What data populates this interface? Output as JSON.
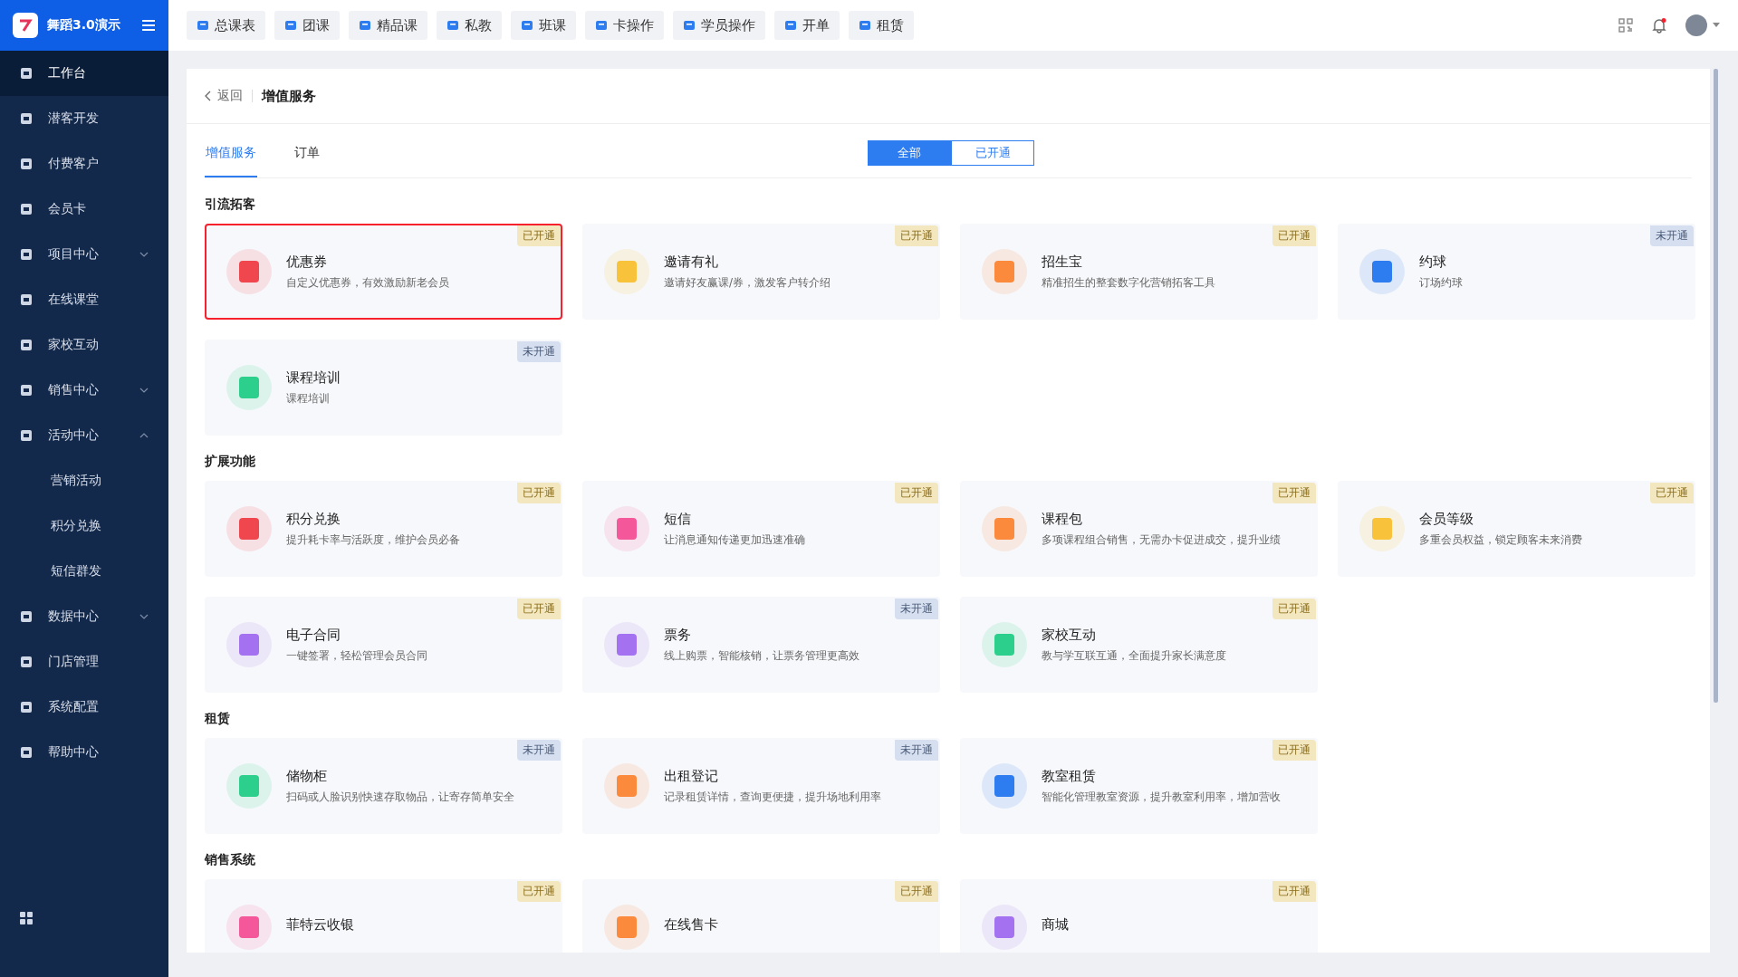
{
  "brand": {
    "name": "舞蹈3.0演示"
  },
  "top_nav": [
    {
      "label": "总课表"
    },
    {
      "label": "团课"
    },
    {
      "label": "精品课"
    },
    {
      "label": "私教"
    },
    {
      "label": "班课"
    },
    {
      "label": "卡操作"
    },
    {
      "label": "学员操作"
    },
    {
      "label": "开单"
    },
    {
      "label": "租赁"
    }
  ],
  "sidebar": {
    "items": [
      {
        "label": "工作台",
        "selected": true
      },
      {
        "label": "潜客开发",
        "selected": false
      },
      {
        "label": "付费客户",
        "selected": false
      },
      {
        "label": "会员卡",
        "selected": false
      },
      {
        "label": "项目中心",
        "selected": false,
        "expanded": false
      },
      {
        "label": "在线课堂",
        "selected": false
      },
      {
        "label": "家校互动",
        "selected": false
      },
      {
        "label": "销售中心",
        "selected": false,
        "expanded": false
      },
      {
        "label": "活动中心",
        "selected": false,
        "expanded": true,
        "children": [
          {
            "label": "营销活动",
            "selected": false
          },
          {
            "label": "积分兑换",
            "selected": false
          },
          {
            "label": "短信群发",
            "selected": false
          }
        ]
      },
      {
        "label": "数据中心",
        "selected": false,
        "expanded": false
      },
      {
        "label": "门店管理",
        "selected": false
      },
      {
        "label": "系统配置",
        "selected": false
      },
      {
        "label": "帮助中心",
        "selected": false
      }
    ]
  },
  "header": {
    "back": "返回",
    "title": "增值服务"
  },
  "tabs": [
    {
      "label": "增值服务",
      "selected": true
    },
    {
      "label": "订单",
      "selected": false
    }
  ],
  "filter": [
    {
      "label": "全部",
      "selected": true
    },
    {
      "label": "已开通",
      "selected": false
    }
  ],
  "sections": [
    {
      "title": "引流拓客",
      "cards": [
        {
          "title": "优惠券",
          "desc": "自定义优惠券，有效激励新老会员",
          "status": "已开通",
          "opened": true,
          "selected": true,
          "color": "#f0474f"
        },
        {
          "title": "邀请有礼",
          "desc": "邀请好友赢课/券，激发客户转介绍",
          "status": "已开通",
          "opened": true,
          "selected": false,
          "color": "#f8c23a"
        },
        {
          "title": "招生宝",
          "desc": "精准招生的整套数字化营销拓客工具",
          "status": "已开通",
          "opened": true,
          "selected": false,
          "color": "#fb8a3c"
        },
        {
          "title": "约球",
          "desc": "订场约球",
          "status": "未开通",
          "opened": false,
          "selected": false,
          "color": "#2d7cf0"
        },
        {
          "title": "课程培训",
          "desc": "课程培训",
          "status": "未开通",
          "opened": false,
          "selected": false,
          "color": "#2ccf8c"
        }
      ]
    },
    {
      "title": "扩展功能",
      "cards": [
        {
          "title": "积分兑换",
          "desc": "提升耗卡率与活跃度，维护会员必备",
          "status": "已开通",
          "opened": true,
          "selected": false,
          "color": "#f0474f"
        },
        {
          "title": "短信",
          "desc": "让消息通知传递更加迅速准确",
          "status": "已开通",
          "opened": true,
          "selected": false,
          "color": "#f5589a"
        },
        {
          "title": "课程包",
          "desc": "多项课程组合销售，无需办卡促进成交，提升业绩",
          "status": "已开通",
          "opened": true,
          "selected": false,
          "color": "#fb8a3c"
        },
        {
          "title": "会员等级",
          "desc": "多重会员权益，锁定顾客未来消费",
          "status": "已开通",
          "opened": true,
          "selected": false,
          "color": "#f8c23a"
        },
        {
          "title": "电子合同",
          "desc": "一键签署，轻松管理会员合同",
          "status": "已开通",
          "opened": true,
          "selected": false,
          "color": "#a472f0"
        },
        {
          "title": "票务",
          "desc": "线上购票，智能核销，让票务管理更高效",
          "status": "未开通",
          "opened": false,
          "selected": false,
          "color": "#a472f0"
        },
        {
          "title": "家校互动",
          "desc": "教与学互联互通，全面提升家长满意度",
          "status": "已开通",
          "opened": true,
          "selected": false,
          "color": "#2ccf8c"
        }
      ]
    },
    {
      "title": "租赁",
      "cards": [
        {
          "title": "储物柜",
          "desc": "扫码或人脸识别快速存取物品，让寄存简单安全",
          "status": "未开通",
          "opened": false,
          "selected": false,
          "color": "#2ccf8c"
        },
        {
          "title": "出租登记",
          "desc": "记录租赁详情，查询更便捷，提升场地利用率",
          "status": "未开通",
          "opened": false,
          "selected": false,
          "color": "#fb8a3c"
        },
        {
          "title": "教室租赁",
          "desc": "智能化管理教室资源，提升教室利用率，增加营收",
          "status": "已开通",
          "opened": true,
          "selected": false,
          "color": "#2d7cf0"
        }
      ]
    },
    {
      "title": "销售系统",
      "cards": [
        {
          "title": "菲特云收银",
          "status": "已开通",
          "opened": true,
          "selected": false,
          "color": "#f5589a"
        },
        {
          "title": "在线售卡",
          "status": "已开通",
          "opened": true,
          "selected": false,
          "color": "#fb8a3c"
        },
        {
          "title": "商城",
          "status": "已开通",
          "opened": true,
          "selected": false,
          "color": "#a472f0"
        }
      ]
    }
  ]
}
